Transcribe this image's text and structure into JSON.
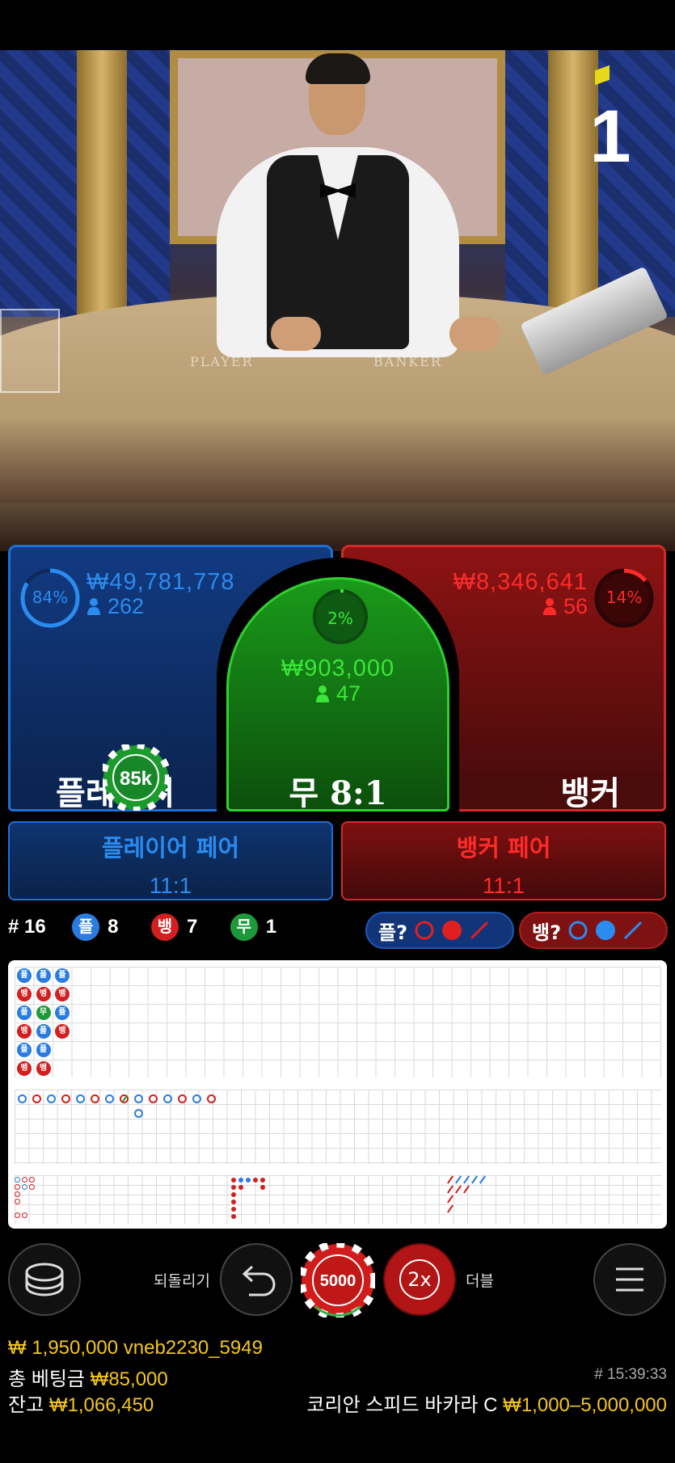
{
  "video": {
    "countdown": "1",
    "table_player_text": "PLAYER",
    "table_banker_text": "BANKER"
  },
  "player": {
    "percent": "84%",
    "percent_value": 0.84,
    "amount": "₩49,781,778",
    "bettors": "262",
    "label": "플레이어",
    "chip": "85k",
    "color": "#2a8cf0"
  },
  "tie": {
    "percent": "2%",
    "percent_value": 0.02,
    "amount": "₩903,000",
    "bettors": "47",
    "label": "무 8:1",
    "color": "#39e639"
  },
  "banker": {
    "percent": "14%",
    "percent_value": 0.14,
    "amount": "₩8,346,641",
    "bettors": "56",
    "label": "뱅커",
    "color": "#ff2a2a"
  },
  "pairs": {
    "player_pair_title": "플레이어 페어",
    "player_pair_odds": "11:1",
    "banker_pair_title": "뱅커 페어",
    "banker_pair_odds": "11:1"
  },
  "stats": {
    "round": "# 16",
    "player_glyph": "플",
    "player_count": "8",
    "banker_glyph": "뱅",
    "banker_count": "7",
    "tie_glyph": "무",
    "tie_count": "1",
    "player_predict": "플?",
    "banker_predict": "뱅?"
  },
  "roadmap": {
    "bead_plate": [
      [
        "플",
        "뱅",
        "플",
        "뱅",
        "플",
        "뱅"
      ],
      [
        "플",
        "뱅",
        "무",
        "플",
        "플",
        "뱅"
      ],
      [
        "플",
        "뱅",
        "플",
        "뱅"
      ]
    ]
  },
  "controls": {
    "undo_label": "되돌리기",
    "chip_value": "5000",
    "double_button": "2x",
    "double_label": "더블"
  },
  "info": {
    "last_bet": "₩ 1,950,000",
    "username": "vneb2230_5949",
    "total_bet_label": "총 베팅금",
    "total_bet_value": "₩85,000",
    "balance_label": "잔고",
    "balance_value": "₩1,066,450",
    "time": "# 15:39:33",
    "table_name": "코리안 스피드 바카라 C",
    "limits": "₩1,000–5,000,000"
  }
}
